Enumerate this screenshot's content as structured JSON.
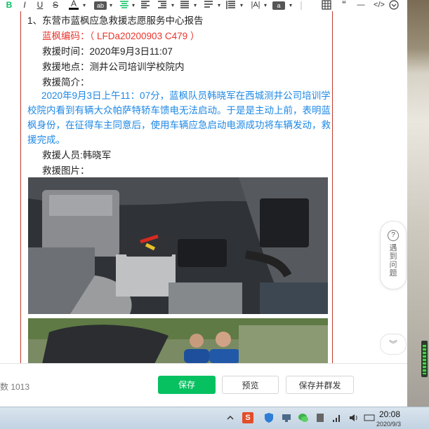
{
  "toolbar": {
    "items": [
      "B",
      "I",
      "U",
      "S",
      "A",
      "ab",
      "align-center",
      "align-left",
      "align-right",
      "align-justify",
      "indent",
      "list",
      "spacing",
      "paragraph",
      "|A|",
      "clear",
      "table",
      "quote",
      "code",
      "expand"
    ]
  },
  "document": {
    "heading": "1、东营市蓝枫应急救援志愿服务中心报告",
    "code_label": "蓝枫编码：（ LFDa20200903 C479 ）",
    "time_label": "救援时间：2020年9月3日11:07",
    "place_label": "救援地点：测井公司培训学校院内",
    "brief_label": "救援简介：",
    "brief_text": "2020年9月3日上午11：07分，蓝枫队员韩晓军在西城测井公司培训学校院内看到有辆大众帕萨特轿车馈电无法启动。于是是主动上前，表明蓝枫身份，在征得车主同意后，使用车辆应急启动电源成功将车辆发动，救援完成。",
    "staff_label": "救援人员:韩晓军",
    "photo_label": "救援图片："
  },
  "help_widget": {
    "label": "遇到问题"
  },
  "bottom": {
    "word_count_label": "数  1013",
    "save": "保存",
    "preview": "预览",
    "save_and_send": "保存并群发"
  },
  "taskbar": {
    "time": "20:08",
    "date": "2020/9/3"
  },
  "colors": {
    "save_green": "#07c160",
    "red_text": "#e8362d",
    "blue_text": "#1e88e5",
    "border_red": "#c0392b"
  }
}
